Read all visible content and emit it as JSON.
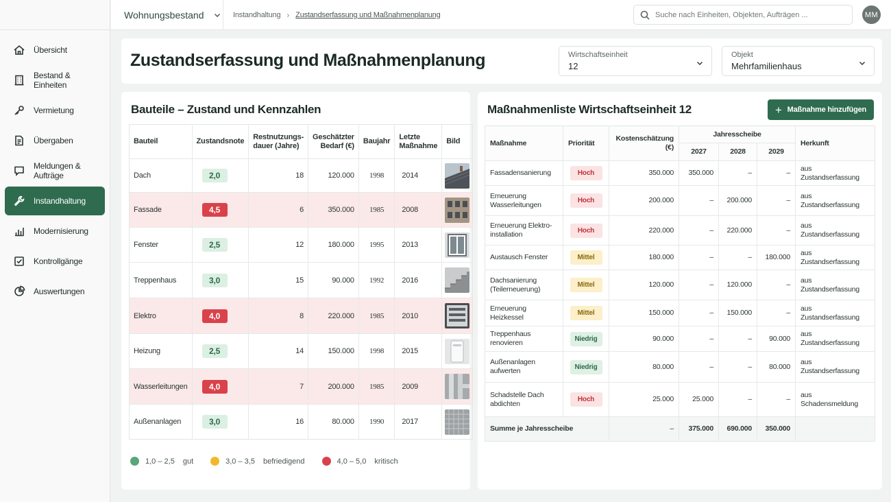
{
  "app": {
    "workspace": "Wohnungsbestand"
  },
  "breadcrumb": {
    "parent": "Instandhaltung",
    "current": "Zustandserfassung und Maßnahmenplanung"
  },
  "search": {
    "placeholder": "Suche nach Einheiten, Objekten, Aufträgen ..."
  },
  "user": {
    "initials": "MM"
  },
  "sidebar": {
    "items": [
      {
        "label": "Übersicht",
        "icon": "home-icon"
      },
      {
        "label": "Bestand & Einheiten",
        "icon": "building-icon"
      },
      {
        "label": "Vermietung",
        "icon": "key-icon"
      },
      {
        "label": "Übergaben",
        "icon": "document-icon"
      },
      {
        "label": "Meldungen & Aufträge",
        "icon": "message-icon"
      },
      {
        "label": "Instandhaltung",
        "icon": "wrench-icon",
        "active": true
      },
      {
        "label": "Modernisierung",
        "icon": "bar-chart-icon"
      },
      {
        "label": "Kontrollgänge",
        "icon": "checkbox-icon"
      },
      {
        "label": "Auswertungen",
        "icon": "pie-chart-icon"
      }
    ]
  },
  "page": {
    "title": "Zustandserfassung und Maßnahmenplanung",
    "unit_select": {
      "label": "Wirtschaftseinheit",
      "value": "12"
    },
    "object_select": {
      "label": "Objekt",
      "value": "Mehrfamilienhaus"
    }
  },
  "components": {
    "title": "Bauteile – Zustand und Kennzahlen",
    "headers": {
      "part": "Bauteil",
      "grade": "Zustandsnote",
      "life": "Restnutzungs-dauer (Jahre)",
      "need": "Geschätzter Bedarf (€)",
      "year": "Baujahr",
      "last": "Letzte Maßnahme",
      "image": "Bild"
    },
    "rows": [
      {
        "part": "Dach",
        "grade": "2,0",
        "level": "good",
        "life": "18",
        "need": "120.000",
        "year": "1998",
        "last": "2014",
        "img": "roof"
      },
      {
        "part": "Fassade",
        "grade": "4,5",
        "level": "crit",
        "life": "6",
        "need": "350.000",
        "year": "1985",
        "last": "2008",
        "img": "facade"
      },
      {
        "part": "Fenster",
        "grade": "2,5",
        "level": "good",
        "life": "12",
        "need": "180.000",
        "year": "1995",
        "last": "2013",
        "img": "window"
      },
      {
        "part": "Treppenhaus",
        "grade": "3,0",
        "level": "mid",
        "life": "15",
        "need": "90.000",
        "year": "1992",
        "last": "2016",
        "img": "stairs"
      },
      {
        "part": "Elektro",
        "grade": "4,0",
        "level": "crit",
        "life": "8",
        "need": "220.000",
        "year": "1985",
        "last": "2010",
        "img": "electric"
      },
      {
        "part": "Heizung",
        "grade": "2,5",
        "level": "good",
        "life": "14",
        "need": "150.000",
        "year": "1998",
        "last": "2015",
        "img": "heater"
      },
      {
        "part": "Wasserleitungen",
        "grade": "4,0",
        "level": "crit",
        "life": "7",
        "need": "200.000",
        "year": "1985",
        "last": "2009",
        "img": "pipes"
      },
      {
        "part": "Außenanlagen",
        "grade": "3,0",
        "level": "mid",
        "life": "16",
        "need": "80.000",
        "year": "1990",
        "last": "2017",
        "img": "paving"
      }
    ],
    "legend": [
      {
        "range": "1,0 – 2,5",
        "label": "gut",
        "color": "#5aa57a"
      },
      {
        "range": "3,0 – 3,5",
        "label": "befriedigend",
        "color": "#f0b92c"
      },
      {
        "range": "4,0 – 5,0",
        "label": "kritisch",
        "color": "#d9424a"
      }
    ]
  },
  "measures": {
    "title": "Maßnahmenliste Wirtschaftseinheit 12",
    "add_label": "Maßnahme hinzufügen",
    "headers": {
      "measure": "Maßnahme",
      "priority": "Priorität",
      "cost": "Kostenschätzung (€)",
      "years_group": "Jahresscheibe",
      "y1": "2027",
      "y2": "2028",
      "y3": "2029",
      "origin": "Herkunft"
    },
    "rows": [
      {
        "measure": "Fassadensanierung",
        "priority": "Hoch",
        "p": "hoch",
        "cost": "350.000",
        "y1": "350.000",
        "y2": "–",
        "y3": "–",
        "origin": "aus Zustandserfassung"
      },
      {
        "measure": "Erneuerung Wasserleitungen",
        "priority": "Hoch",
        "p": "hoch",
        "cost": "200.000",
        "y1": "–",
        "y2": "200.000",
        "y3": "–",
        "origin": "aus Zustandserfassung"
      },
      {
        "measure": "Erneuerung Elektro-installation",
        "priority": "Hoch",
        "p": "hoch",
        "cost": "220.000",
        "y1": "–",
        "y2": "220.000",
        "y3": "–",
        "origin": "aus Zustandserfassung"
      },
      {
        "measure": "Austausch Fenster",
        "priority": "Mittel",
        "p": "mittel",
        "cost": "180.000",
        "y1": "–",
        "y2": "–",
        "y3": "180.000",
        "origin": "aus Zustandserfassung"
      },
      {
        "measure": "Dachsanierung (Teilerneuerung)",
        "priority": "Mittel",
        "p": "mittel",
        "cost": "120.000",
        "y1": "–",
        "y2": "120.000",
        "y3": "–",
        "origin": "aus Zustandserfassung"
      },
      {
        "measure": "Erneuerung Heizkessel",
        "priority": "Mittel",
        "p": "mittel",
        "cost": "150.000",
        "y1": "–",
        "y2": "150.000",
        "y3": "–",
        "origin": "aus Zustandserfassung"
      },
      {
        "measure": "Treppenhaus renovieren",
        "priority": "Niedrig",
        "p": "niedrig",
        "cost": "90.000",
        "y1": "–",
        "y2": "–",
        "y3": "90.000",
        "origin": "aus Zustandserfassung"
      },
      {
        "measure": "Außenanlagen aufwerten",
        "priority": "Niedrig",
        "p": "niedrig",
        "cost": "80.000",
        "y1": "–",
        "y2": "–",
        "y3": "80.000",
        "origin": "aus Zustandserfassung"
      },
      {
        "measure": "Schadstelle Dach abdichten",
        "priority": "Hoch",
        "p": "hoch",
        "cost": "25.000",
        "y1": "25.000",
        "y2": "–",
        "y3": "–",
        "origin": "aus Schadensmeldung"
      }
    ],
    "sum": {
      "label": "Summe je Jahresscheibe",
      "cost": "–",
      "y1": "375.000",
      "y2": "690.000",
      "y3": "350.000"
    }
  }
}
